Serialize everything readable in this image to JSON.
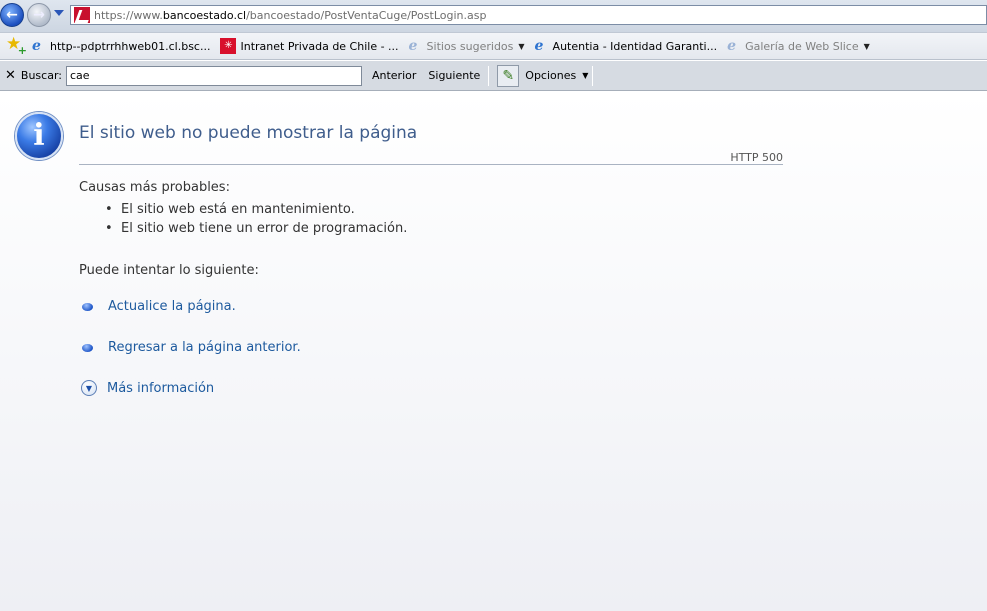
{
  "address_bar": {
    "url_prefix": "https://www.",
    "url_host": "bancoestado.cl",
    "url_path": "/bancoestado/PostVentaCuge/PostLogin.asp",
    "back_icon": "back-arrow-icon",
    "forward_icon": "forward-arrow-icon"
  },
  "favorites": {
    "items": [
      {
        "label": "http--pdptrrhhweb01.cl.bsc...",
        "icon": "ie-page-icon"
      },
      {
        "label": "Intranet Privada de Chile - ...",
        "icon": "santander-flame-icon"
      },
      {
        "label": "Sitios sugeridos",
        "icon": "ie-page-icon",
        "dropdown": true
      },
      {
        "label": "Autentia - Identidad Garanti...",
        "icon": "ie-page-icon"
      },
      {
        "label": "Galería de Web Slice",
        "icon": "ie-page-icon",
        "dropdown": true
      }
    ]
  },
  "find_bar": {
    "label": "Buscar:",
    "value": "cae",
    "prev_label": "Anterior",
    "next_label": "Siguiente",
    "options_label": "Opciones"
  },
  "error_page": {
    "title": "El sitio web no puede mostrar la página",
    "http_code": "HTTP 500",
    "causes_heading": "Causas más probables:",
    "causes": [
      "El sitio web está en mantenimiento.",
      "El sitio web tiene un error de programación."
    ],
    "try_heading": "Puede intentar lo siguiente:",
    "actions": [
      {
        "label": "Actualice la página."
      },
      {
        "label": "Regresar a la página anterior."
      }
    ],
    "more_info_label": "Más información"
  },
  "colors": {
    "title": "#3f5d8c",
    "link": "#1d5a9e",
    "santander_red": "#d8102c"
  }
}
